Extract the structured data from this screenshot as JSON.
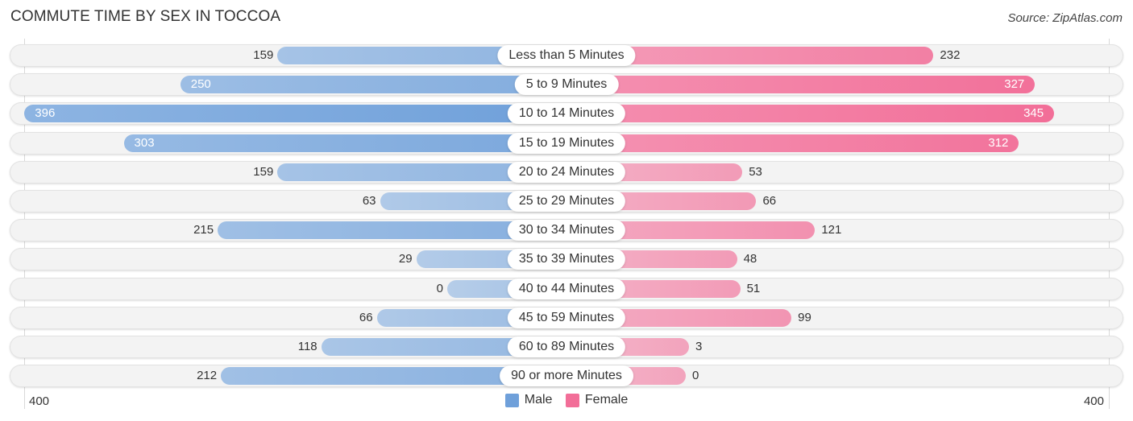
{
  "chart_data": {
    "type": "bar",
    "orientation": "horizontal-diverging",
    "title": "COMMUTE TIME BY SEX IN TOCCOA",
    "source": "Source: ZipAtlas.com",
    "categories": [
      "Less than 5 Minutes",
      "5 to 9 Minutes",
      "10 to 14 Minutes",
      "15 to 19 Minutes",
      "20 to 24 Minutes",
      "25 to 29 Minutes",
      "30 to 34 Minutes",
      "35 to 39 Minutes",
      "40 to 44 Minutes",
      "45 to 59 Minutes",
      "60 to 89 Minutes",
      "90 or more Minutes"
    ],
    "series": [
      {
        "name": "Male",
        "color": "#6fa0da",
        "values": [
          159,
          250,
          396,
          303,
          159,
          63,
          215,
          29,
          0,
          66,
          118,
          212
        ]
      },
      {
        "name": "Female",
        "color": "#f26e98",
        "values": [
          232,
          327,
          345,
          312,
          53,
          66,
          121,
          48,
          51,
          99,
          3,
          0
        ]
      }
    ],
    "xlim": [
      400,
      400
    ],
    "tick_labels": {
      "left": "400",
      "right": "400"
    },
    "legend": {
      "position": "bottom-center",
      "entries": [
        "Male",
        "Female"
      ]
    },
    "grid": false
  }
}
